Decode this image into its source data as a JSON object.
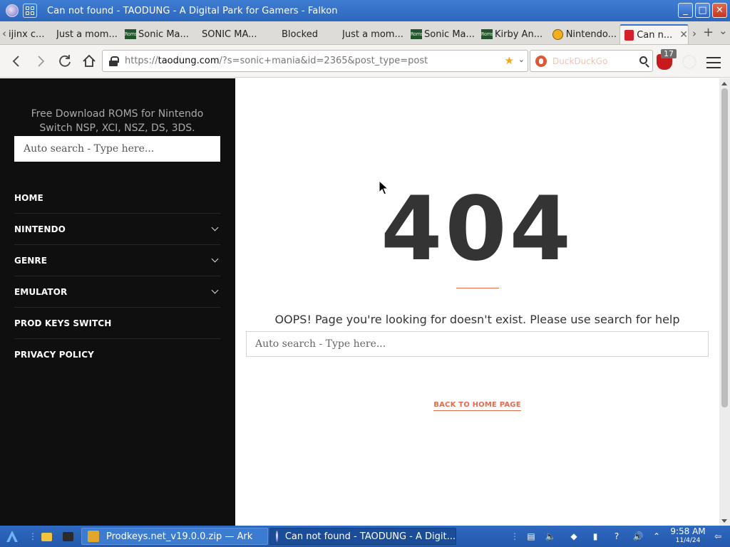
{
  "window": {
    "title": "Can not found - TAODUNG - A Digital Park for Gamers - Falkon",
    "buttons": {
      "minimize": "_",
      "maximize": "□",
      "close": "✕"
    }
  },
  "tabs": [
    {
      "label": "ijinx c...",
      "favicon": "none"
    },
    {
      "label": "Just a mom...",
      "favicon": "none"
    },
    {
      "label": "Sonic Ma...",
      "favicon": "roms-icon"
    },
    {
      "label": "SONIC MA...",
      "favicon": "none"
    },
    {
      "label": "Blocked",
      "favicon": "none"
    },
    {
      "label": "Just a mom...",
      "favicon": "none"
    },
    {
      "label": "Sonic Ma...",
      "favicon": "roms-icon"
    },
    {
      "label": "Kirby An...",
      "favicon": "roms-icon"
    },
    {
      "label": "Nintendo...",
      "favicon": "nintendo-icon"
    },
    {
      "label": "Can n...",
      "favicon": "taodung-icon",
      "active": true
    }
  ],
  "tab_icon_text": {
    "roms": "Roms",
    "prev": "‹",
    "next": "›",
    "new": "+",
    "list": "⌄",
    "close": "✕"
  },
  "navbar": {
    "url": {
      "scheme": "https://",
      "host": "taodung.com",
      "path": "/?s=sonic+mania&id=2365&post_type=post"
    },
    "search_placeholder": "DuckDuckGo",
    "ublock_count": "17"
  },
  "sidebar": {
    "tagline": "Free Download ROMS for Nintendo Switch NSP, XCI, NSZ, DS, 3DS.",
    "search_placeholder": "Auto search - Type here...",
    "menu": [
      {
        "label": "HOME",
        "has_submenu": false
      },
      {
        "label": "NINTENDO",
        "has_submenu": true
      },
      {
        "label": "GENRE",
        "has_submenu": true
      },
      {
        "label": "EMULATOR",
        "has_submenu": true
      },
      {
        "label": "PROD KEYS SWITCH",
        "has_submenu": false
      },
      {
        "label": "PRIVACY POLICY",
        "has_submenu": false
      }
    ]
  },
  "main": {
    "error_code": "404",
    "message": "OOPS! Page you're looking for doesn't exist. Please use search for help",
    "search_placeholder": "Auto search - Type here...",
    "back_link": "BACK TO HOME PAGE"
  },
  "taskbar": {
    "items": [
      {
        "label": "Prodkeys.net_v19.0.0.zip — Ark",
        "active": false
      },
      {
        "label": "Can not found - TAODUNG - A Digit...",
        "active": true
      }
    ],
    "clock": {
      "time": "9:58 AM",
      "date": "11/4/24"
    }
  },
  "colors": {
    "accent": "#e86a4e",
    "sidebar_bg": "#0f0f0f",
    "titlebar": "#3f7dd2",
    "text_dark": "#343434"
  }
}
